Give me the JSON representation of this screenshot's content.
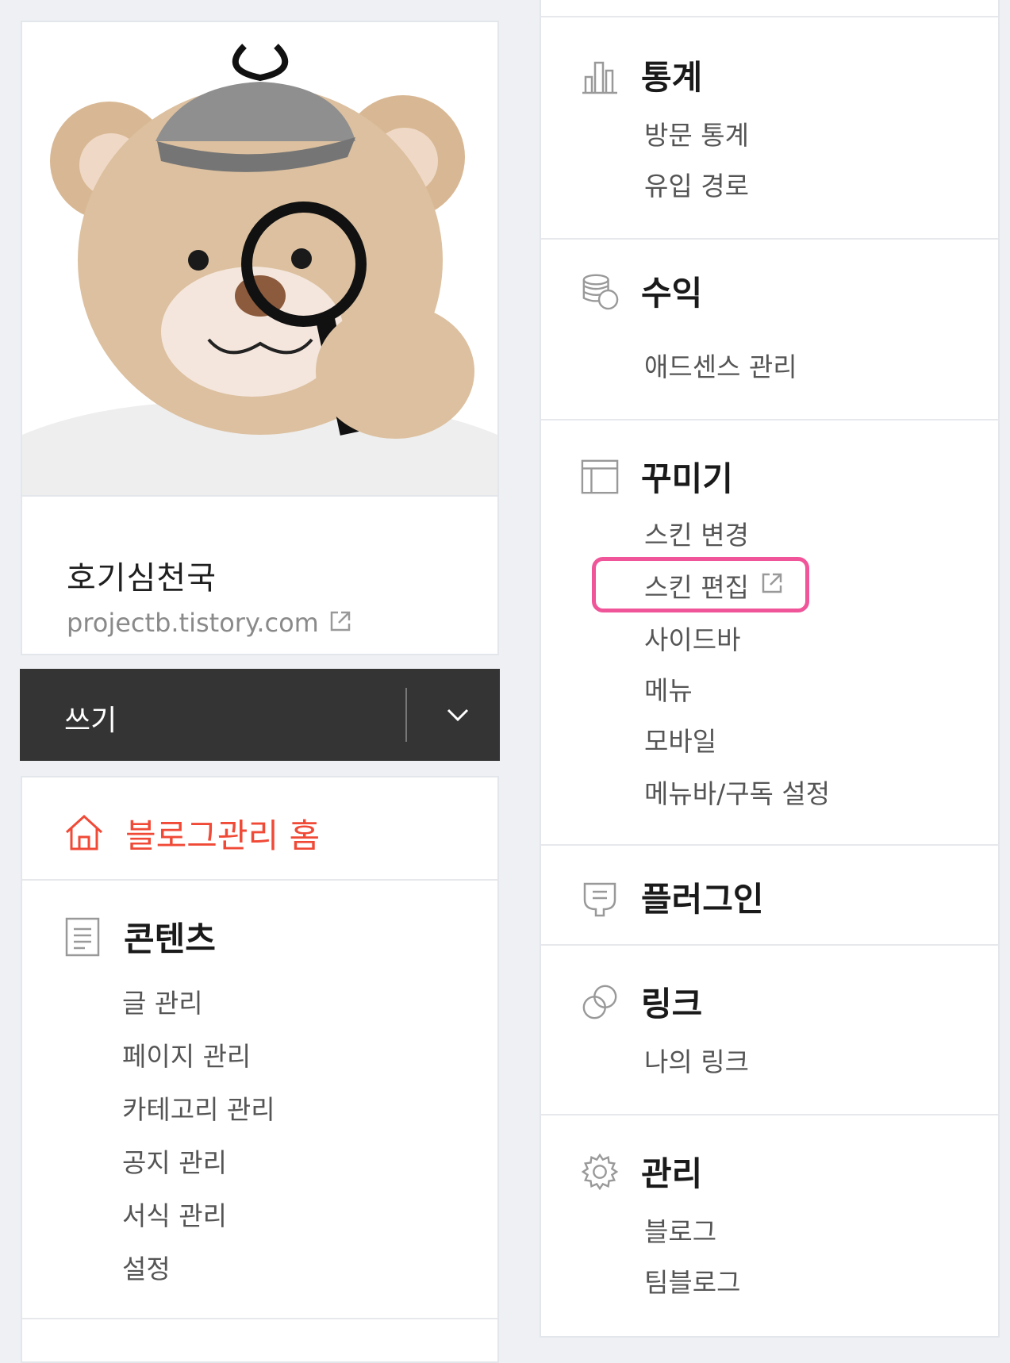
{
  "profile": {
    "blog_name": "호기심천국",
    "blog_url": "projectb.tistory.com"
  },
  "write": {
    "label": "쓰기"
  },
  "home": {
    "label": "블로그관리 홈"
  },
  "contents": {
    "title": "콘텐츠",
    "items": [
      "글 관리",
      "페이지 관리",
      "카테고리 관리",
      "공지 관리",
      "서식 관리",
      "설정"
    ]
  },
  "stats": {
    "title": "통계",
    "items": [
      "방문 통계",
      "유입 경로"
    ]
  },
  "revenue": {
    "title": "수익",
    "items": [
      "애드센스 관리"
    ]
  },
  "decorate": {
    "title": "꾸미기",
    "items": [
      "스킨 변경",
      "스킨 편집",
      "사이드바",
      "메뉴",
      "모바일",
      "메뉴바/구독 설정"
    ]
  },
  "plugin": {
    "title": "플러그인"
  },
  "link": {
    "title": "링크",
    "items": [
      "나의 링크"
    ]
  },
  "manage": {
    "title": "관리",
    "items": [
      "블로그",
      "팀블로그"
    ]
  },
  "colors": {
    "accent": "#f04a37",
    "highlight": "#f0559a",
    "dark_bar": "#343434"
  }
}
